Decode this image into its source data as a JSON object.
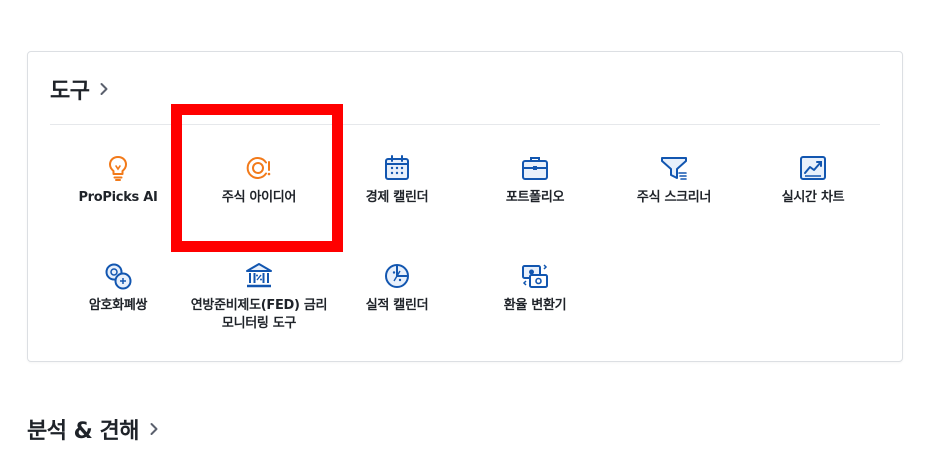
{
  "tools_section": {
    "title": "도구",
    "items": [
      {
        "label": "ProPicks AI",
        "icon": "lightbulb-icon"
      },
      {
        "label": "주식 아이디어",
        "icon": "target-idea-icon"
      },
      {
        "label": "경제 캘린더",
        "icon": "calendar-icon"
      },
      {
        "label": "포트폴리오",
        "icon": "briefcase-icon"
      },
      {
        "label": "주식 스크리너",
        "icon": "funnel-icon"
      },
      {
        "label": "실시간 차트",
        "icon": "chart-icon"
      },
      {
        "label": "암호화폐쌍",
        "icon": "crypto-coins-icon"
      },
      {
        "label": "연방준비제도(FED) 금리\n모니터링 도구",
        "icon": "bank-icon"
      },
      {
        "label": "실적 캘린더",
        "icon": "earnings-pie-icon"
      },
      {
        "label": "환율 변환기",
        "icon": "currency-exchange-icon"
      }
    ]
  },
  "analysis_section": {
    "title": "분석 & 견해"
  },
  "colors": {
    "accent_blue": "#1256b0",
    "accent_orange": "#f27a1a",
    "highlight_red": "#ff0000",
    "card_border": "#dcdfe3"
  }
}
